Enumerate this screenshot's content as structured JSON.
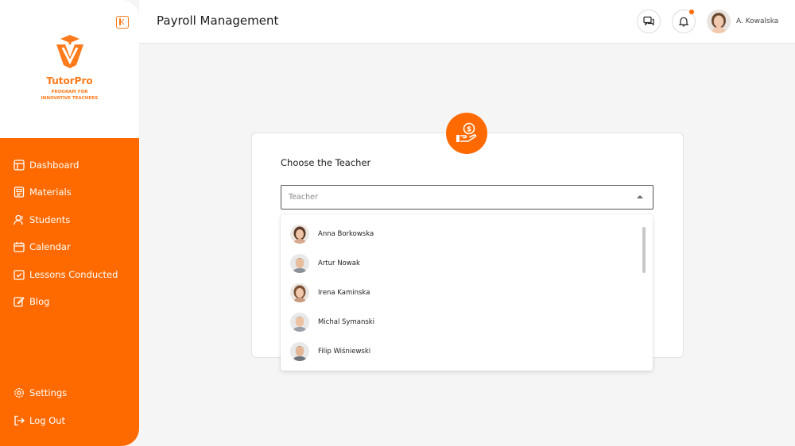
{
  "brand": {
    "name": "TutorPro",
    "tagline_line1": "PROGRAM FOR",
    "tagline_line2": "INNOVATIVE TEACHERS",
    "accent_color": "#ff6a00"
  },
  "sidebar": {
    "items": [
      {
        "label": "Dashboard",
        "icon": "dashboard-icon"
      },
      {
        "label": "Materials",
        "icon": "materials-icon"
      },
      {
        "label": "Students",
        "icon": "students-icon"
      },
      {
        "label": "Calendar",
        "icon": "calendar-icon"
      },
      {
        "label": "Lessons Conducted",
        "icon": "check-calendar-icon"
      },
      {
        "label": "Blog",
        "icon": "edit-icon"
      }
    ],
    "bottom_items": [
      {
        "label": "Settings",
        "icon": "gear-icon"
      },
      {
        "label": "Log Out",
        "icon": "logout-icon"
      }
    ]
  },
  "header": {
    "title": "Payroll Management",
    "user_name": "A. Kowalska"
  },
  "card": {
    "title": "Choose the Teacher",
    "select_placeholder": "Teacher"
  },
  "teachers": [
    {
      "name": "Anna Borkowska",
      "gender": "female"
    },
    {
      "name": "Artur Nowak",
      "gender": "male"
    },
    {
      "name": "Irena Kaminska",
      "gender": "female"
    },
    {
      "name": "Michal Symanski",
      "gender": "male"
    },
    {
      "name": "Filip Wiśniewski",
      "gender": "male"
    }
  ]
}
